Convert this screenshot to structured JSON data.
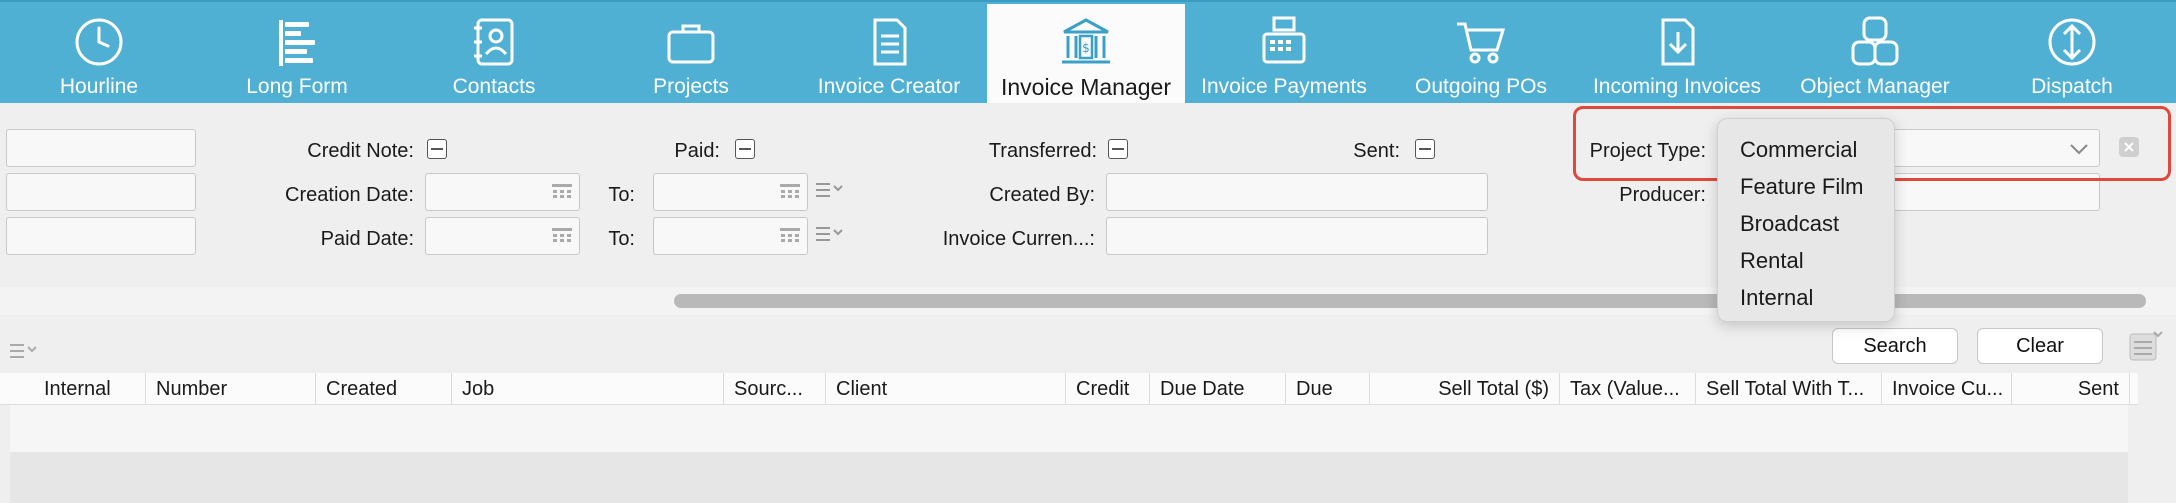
{
  "toolbar": {
    "items": [
      {
        "label": "Hourline",
        "icon": "clock-icon"
      },
      {
        "label": "Long Form",
        "icon": "gantt-icon"
      },
      {
        "label": "Contacts",
        "icon": "address-book-icon"
      },
      {
        "label": "Projects",
        "icon": "briefcase-icon"
      },
      {
        "label": "Invoice Creator",
        "icon": "document-icon"
      },
      {
        "label": "Invoice Manager",
        "icon": "bank-icon"
      },
      {
        "label": "Invoice Payments",
        "icon": "cash-register-icon"
      },
      {
        "label": "Outgoing POs",
        "icon": "cart-icon"
      },
      {
        "label": "Incoming Invoices",
        "icon": "download-doc-icon"
      },
      {
        "label": "Object Manager",
        "icon": "blocks-icon"
      },
      {
        "label": "Dispatch",
        "icon": "up-down-arrows-icon"
      }
    ],
    "active": "Invoice Manager"
  },
  "filters": {
    "credit_note": "Credit Note:",
    "paid": "Paid:",
    "transferred": "Transferred:",
    "sent": "Sent:",
    "project_type": "Project Type:",
    "creation_date": "Creation Date:",
    "to1": "To:",
    "created_by": "Created By:",
    "producer": "Producer:",
    "paid_date": "Paid Date:",
    "to2": "To:",
    "invoice_currency": "Invoice Curren...:"
  },
  "dropdown": {
    "options": [
      "Commercial",
      "Feature Film",
      "Broadcast",
      "Rental",
      "Internal"
    ]
  },
  "buttons": {
    "search": "Search",
    "clear": "Clear"
  },
  "table": {
    "columns": [
      "Internal",
      "Number",
      "Created",
      "Job",
      "Sourc...",
      "Client",
      "Credit",
      "Due Date",
      "Due",
      "Sell Total ($)",
      "Tax (Value...",
      "Sell Total With T...",
      "Invoice Cu...",
      "Sent"
    ]
  },
  "colors": {
    "toolbar": "#4fb0d3",
    "highlight": "#e0483d"
  }
}
